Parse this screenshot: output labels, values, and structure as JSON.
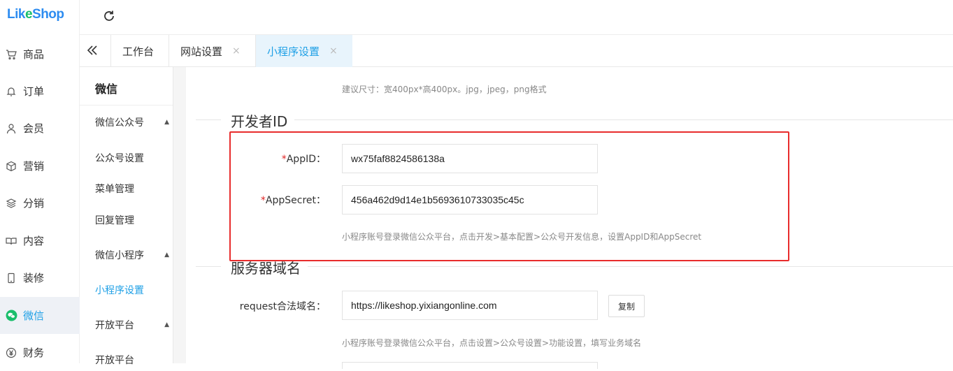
{
  "app": {
    "logo_text_a": "Lik",
    "logo_text_b": "e",
    "logo_text_c": "Shop"
  },
  "nav": {
    "items": [
      {
        "label": "商品",
        "icon": "cart-icon"
      },
      {
        "label": "订单",
        "icon": "bell-icon"
      },
      {
        "label": "会员",
        "icon": "user-icon"
      },
      {
        "label": "营销",
        "icon": "box-icon"
      },
      {
        "label": "分销",
        "icon": "layers-icon"
      },
      {
        "label": "内容",
        "icon": "book-icon"
      },
      {
        "label": "装修",
        "icon": "phone-icon"
      },
      {
        "label": "微信",
        "icon": "wechat-icon"
      },
      {
        "label": "财务",
        "icon": "yen-icon"
      }
    ],
    "active": "微信"
  },
  "tabs": [
    {
      "label": "工作台",
      "closable": false
    },
    {
      "label": "网站设置",
      "closable": true
    },
    {
      "label": "小程序设置",
      "closable": true,
      "active": true
    }
  ],
  "tab_close_glyph": "×",
  "submenu": {
    "title": "微信",
    "groups": [
      {
        "label": "微信公众号",
        "items": [
          "公众号设置",
          "菜单管理",
          "回复管理"
        ]
      },
      {
        "label": "微信小程序",
        "items": [
          "小程序设置"
        ]
      },
      {
        "label": "开放平台",
        "items": [
          "开放平台"
        ]
      }
    ],
    "active_item": "小程序设置",
    "arrow_glyph": "▲"
  },
  "content": {
    "size_hint": "建议尺寸：宽400px*高400px。jpg，jpeg，png格式",
    "dev_section": "开发者ID",
    "appid_label": "AppID：",
    "appid_value": "wx75faf8824586138a",
    "appsecret_label": "AppSecret：",
    "appsecret_value": "456a462d9d14e1b5693610733035c45c",
    "required_mark": "*",
    "dev_hint": "小程序账号登录微信公众平台，点击开发>基本配置>公众号开发信息，设置AppID和AppSecret",
    "server_section": "服务器域名",
    "request_label": "request合法域名：",
    "request_value": "https://likeshop.yixiangonline.com",
    "copy_label": "复制",
    "server_hint": "小程序账号登录微信公众平台，点击设置>公众号设置>功能设置，填写业务域名"
  },
  "colors": {
    "accent": "#1fa0e6",
    "highlight_border": "#e82c2c",
    "wechat_green": "#19be6b"
  }
}
